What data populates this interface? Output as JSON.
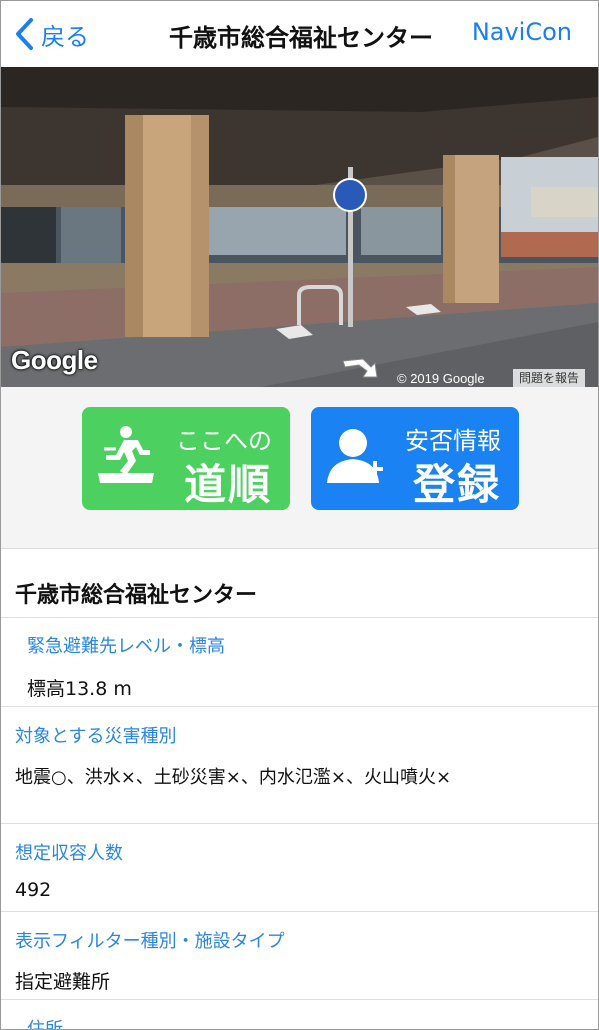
{
  "nav": {
    "back_label": "戻る",
    "title": "千歳市総合福祉センター",
    "right_label": "NaviCon"
  },
  "streetview": {
    "logo": "Google",
    "copyright": "© 2019 Google",
    "report_label": "問題を報告"
  },
  "buttons": {
    "route": {
      "small": "ここへの",
      "large": "道順",
      "color": "#4cd05f",
      "icon": "running-exit-icon"
    },
    "safety": {
      "small": "安否情報",
      "large": "登録",
      "color": "#1a82f2",
      "icon": "add-person-icon"
    }
  },
  "detail": {
    "name": "千歳市総合福祉センター",
    "rows": [
      {
        "label": "緊急避難先レベル・標高",
        "value": "標高13.8 m"
      },
      {
        "label": "対象とする災害種別",
        "value": "地震○、洪水×、土砂災害×、内水氾濫×、火山噴火×"
      },
      {
        "label": "想定収容人数",
        "value": "492"
      },
      {
        "label": "表示フィルター種別・施設タイプ",
        "value": "指定避難所"
      },
      {
        "label": "住所",
        "value": ""
      }
    ]
  },
  "colors": {
    "accent": "#1a7ff0",
    "label_blue": "#2a86e0"
  }
}
